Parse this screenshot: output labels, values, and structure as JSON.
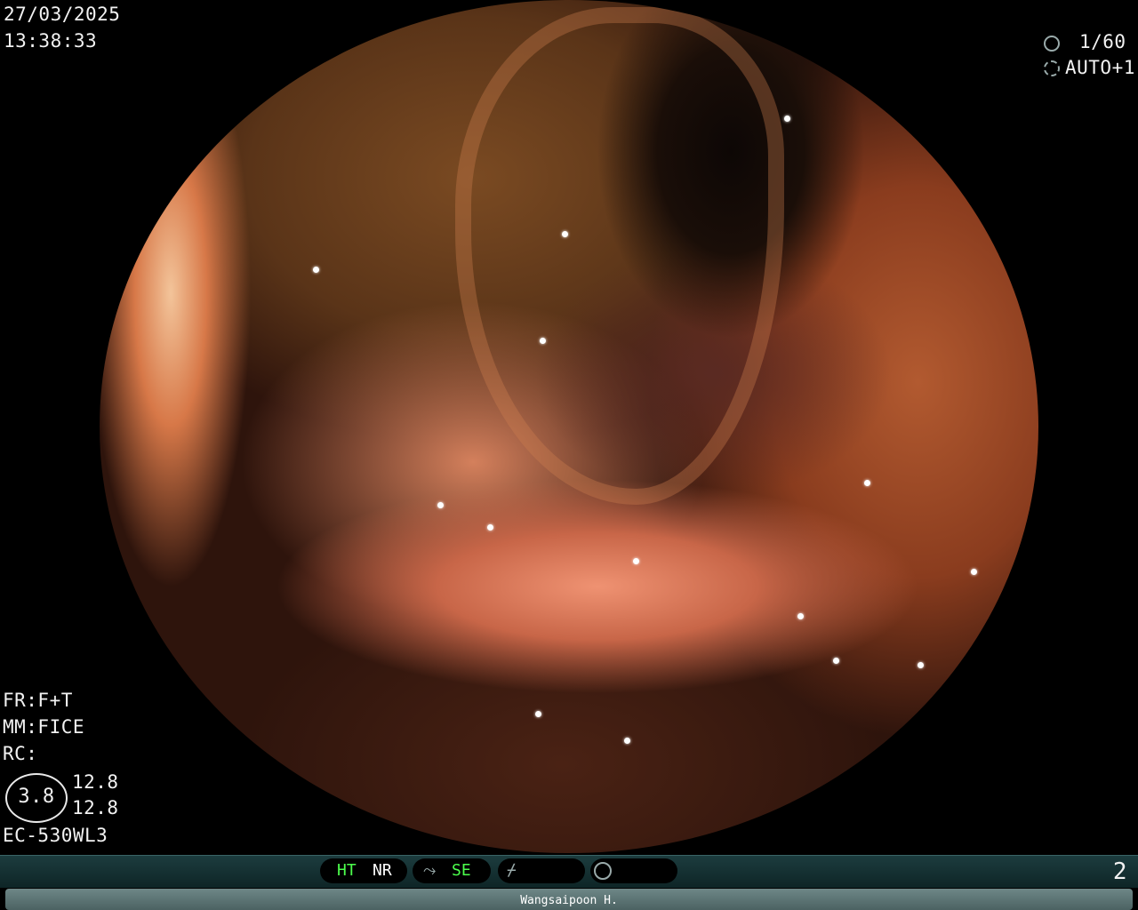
{
  "overlay": {
    "date": "27/03/2025",
    "time": "13:38:33",
    "shutter": "1/60",
    "exposure": "AUTO+1",
    "fr": "FR:F+T",
    "mm": "MM:FICE",
    "rc": "RC:",
    "ring_value": "3.8",
    "val_top": "12.8",
    "val_bottom": "12.8",
    "scope_model": "EC-530WL3"
  },
  "statusbar": {
    "ht": "HT",
    "nr": "NR",
    "se": "SE",
    "page": "2",
    "ht_color": "#4cff4c",
    "se_color": "#4cff4c"
  },
  "patient": {
    "name": "Wangsaipoon H."
  },
  "icons": {
    "shutter_icon": "aperture-icon",
    "exposure_icon": "iris-icon",
    "tone_icon": "tone-curve-icon",
    "edge_icon": "edge-icon",
    "color_icon": "color-mode-icon"
  }
}
